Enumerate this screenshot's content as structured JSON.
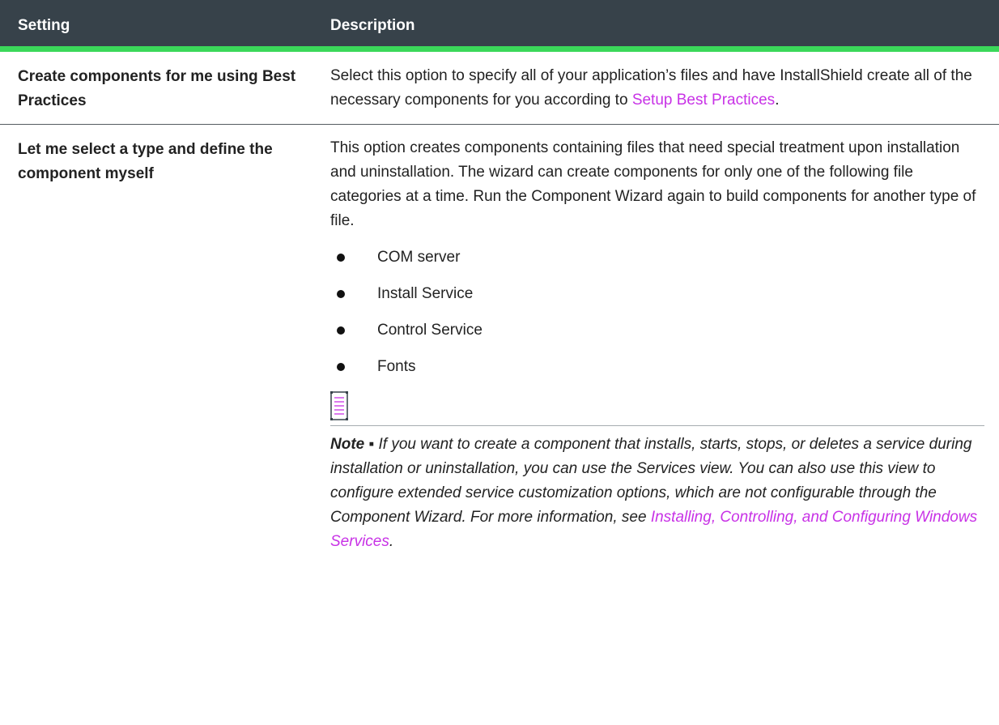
{
  "table": {
    "headers": {
      "setting": "Setting",
      "description": "Description"
    },
    "row1": {
      "setting": "Create components for me using Best Practices",
      "desc_text": "Select this option to specify all of your application’s files and have InstallShield create all of the necessary components for you according to ",
      "desc_link": "Setup Best Practices",
      "desc_end": "."
    },
    "row2": {
      "setting": "Let me select a type and define the component myself",
      "desc_text": "This option creates components containing files that need special treatment upon installation and uninstallation. The wizard can create components for only one of the following file categories at a time. Run the Component Wizard again to build components for another type of file.",
      "bullets": [
        "COM server",
        "Install Service",
        "Control Service",
        "Fonts"
      ],
      "note_label": "Note ▪",
      "note_text": " If you want to create a component that installs, starts, stops, or deletes a service during installation or uninstallation, you can use the Services view. You can also use this view to configure extended service customization options, which are not configurable through the Component Wizard. For more information, see ",
      "note_link": "Installing, Controlling, and Configuring Windows Services",
      "note_end": "."
    }
  },
  "colors": {
    "header_bg": "#37424a",
    "header_accent": "#3bd85a",
    "link": "#c832e6"
  },
  "icons": {
    "note": "note-document-icon"
  }
}
